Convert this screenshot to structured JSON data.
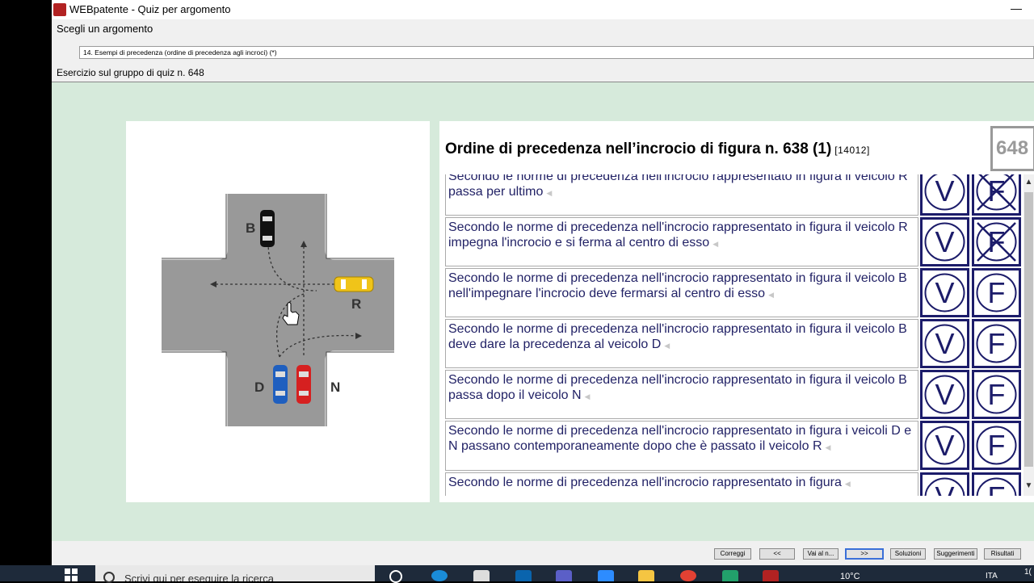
{
  "window": {
    "title": "WEBpatente - Quiz per argomento",
    "minimize": "—"
  },
  "topic": {
    "label": "Scegli un argomento",
    "selected": "14. Esempi di precedenza (ordine di precedenza agli incroci) (*)"
  },
  "exercise": {
    "label": "Esercizio sul gruppo di quiz n. 648"
  },
  "figure": {
    "vehicle_labels": [
      "B",
      "R",
      "D",
      "N"
    ]
  },
  "question": {
    "title": "Ordine di precedenza nell’incrocio di figura n. 638 (1)",
    "code": "[14012]",
    "number": "648",
    "true_label": "V",
    "false_label": "F",
    "statements": [
      {
        "text": "Secondo le norme di precedenza nell'incrocio rappresentato in figura il veicolo R passa per ultimo",
        "answered_false": true
      },
      {
        "text": "Secondo le norme di precedenza nell'incrocio rappresentato in figura il veicolo R impegna l'incrocio e si ferma al centro di esso",
        "answered_false": true
      },
      {
        "text": "Secondo le norme di precedenza nell'incrocio rappresentato in figura il veicolo B nell'impegnare l'incrocio deve fermarsi al centro di esso",
        "answered_false": false
      },
      {
        "text": "Secondo le norme di precedenza nell'incrocio rappresentato in figura il veicolo B deve dare la precedenza al veicolo D",
        "answered_false": false
      },
      {
        "text": "Secondo le norme di precedenza nell'incrocio rappresentato in figura il veicolo B passa dopo il veicolo N",
        "answered_false": false
      },
      {
        "text": "Secondo le norme di precedenza nell'incrocio rappresentato in figura i veicoli D e N passano contemporaneamente dopo che è passato il veicolo R",
        "answered_false": false
      },
      {
        "text": "Secondo le norme di precedenza nell'incrocio rappresentato in figura",
        "answered_false": false
      }
    ]
  },
  "buttons": {
    "correggi": "Correggi",
    "prev": "<<",
    "goto": "Vai al n...",
    "next": ">>",
    "soluzioni": "Soluzioni",
    "suggerimenti": "Suggerimenti",
    "risultati": "Risultati"
  },
  "taskbar": {
    "search_placeholder": "Scrivi qui per eseguire la ricerca",
    "weather": "10°C",
    "language": "ITA",
    "clock": "1("
  }
}
